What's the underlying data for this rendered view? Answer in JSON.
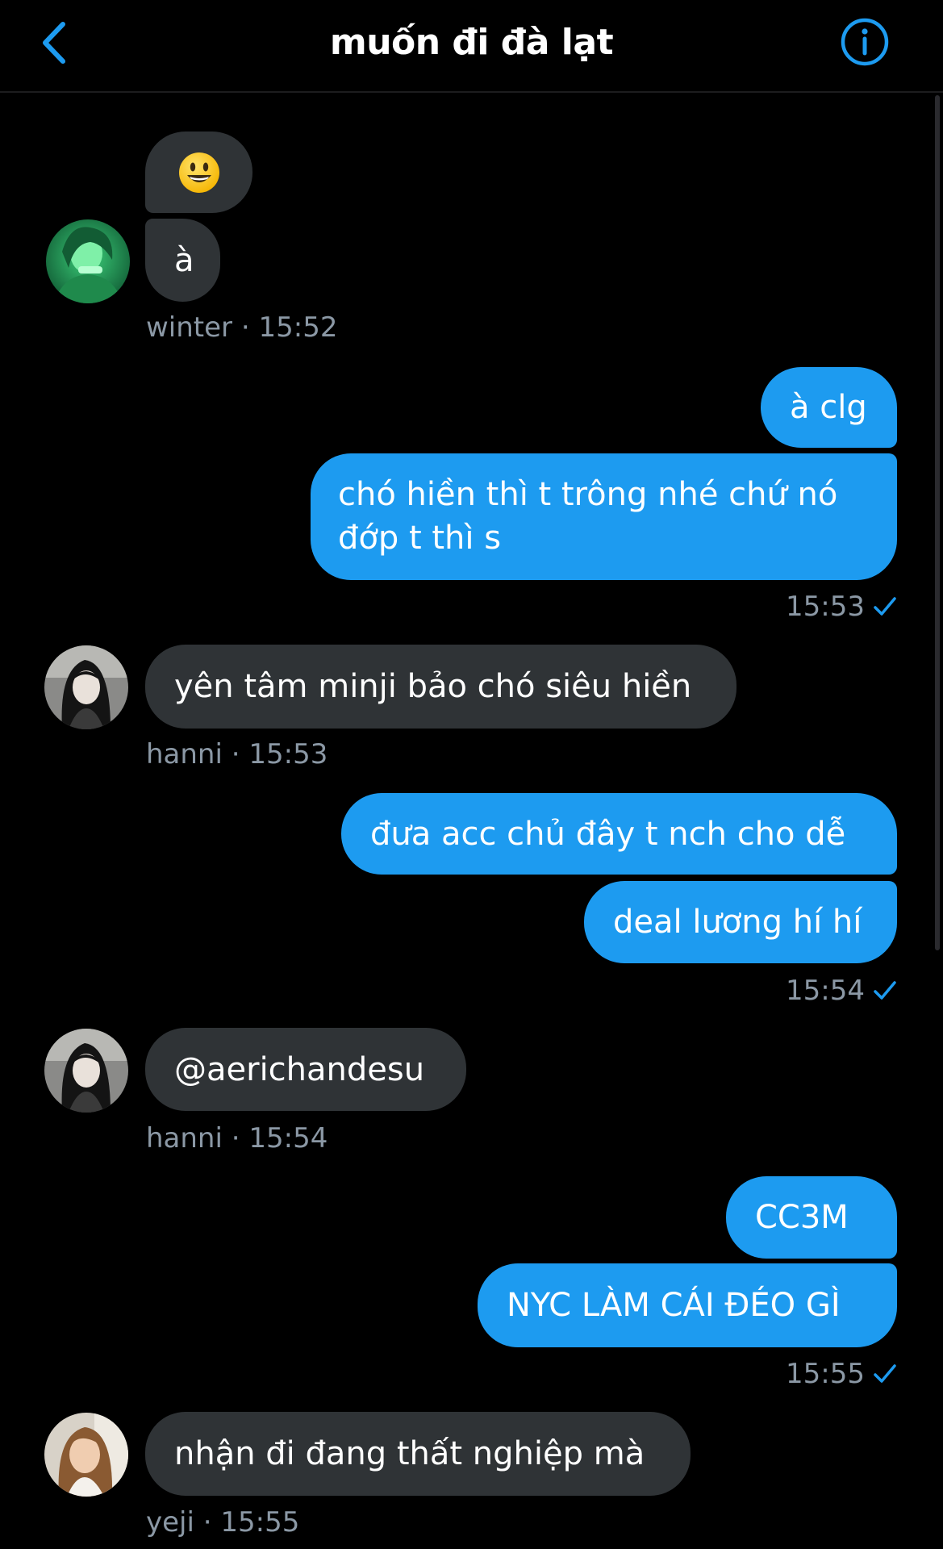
{
  "header": {
    "title": "muốn đi đà lạt",
    "back_icon": "chevron-left-icon",
    "info_icon": "info-circle-icon",
    "accent_color": "#1d9bf0"
  },
  "messages": [
    {
      "direction": "in",
      "type": "emoji",
      "emoji": "smiley-face-emoji"
    },
    {
      "direction": "in",
      "text": "à"
    },
    {
      "meta": {
        "sender": "winter",
        "time": "15:52"
      }
    },
    {
      "direction": "out",
      "text": "à clg"
    },
    {
      "direction": "out",
      "text": "chó hiền thì t trông nhé chứ nó đớp t thì s"
    },
    {
      "meta_out": {
        "time": "15:53",
        "status_icon": "read-check-icon"
      }
    },
    {
      "direction": "in",
      "text": "yên tâm minji bảo chó siêu hiền"
    },
    {
      "meta": {
        "sender": "hanni",
        "time": "15:53"
      }
    },
    {
      "direction": "out",
      "text": "đưa acc chủ đây t nch cho dễ"
    },
    {
      "direction": "out",
      "text": "deal lương hí hí"
    },
    {
      "meta_out": {
        "time": "15:54",
        "status_icon": "read-check-icon"
      }
    },
    {
      "direction": "in",
      "text": "@aerichandesu"
    },
    {
      "meta": {
        "sender": "hanni",
        "time": "15:54"
      }
    },
    {
      "direction": "out",
      "text": "CC3M"
    },
    {
      "direction": "out",
      "text": "NYC LÀM CÁI ĐÉO GÌ"
    },
    {
      "meta_out": {
        "time": "15:55",
        "status_icon": "read-check-icon"
      }
    },
    {
      "direction": "in",
      "text": "nhận đi đang thất nghiệp mà"
    },
    {
      "meta": {
        "sender": "yeji",
        "time": "15:55"
      }
    }
  ],
  "labels": {
    "separator": " · "
  }
}
